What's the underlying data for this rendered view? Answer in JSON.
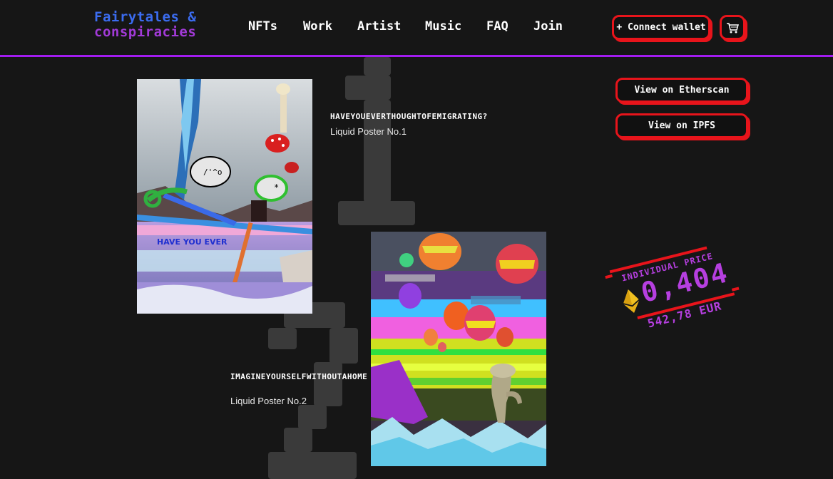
{
  "header": {
    "logo_line1": "Fairytales &",
    "logo_line2": "conspiracies",
    "nav": [
      "NFTs",
      "Work",
      "Artist",
      "Music",
      "FAQ",
      "Join"
    ],
    "connect_label": "+ Connect wallet",
    "cart_icon": "cart-icon"
  },
  "actions": {
    "etherscan_label": "View on Etherscan",
    "ipfs_label": "View on IPFS"
  },
  "posters": [
    {
      "number": "1",
      "title": "HAVEYOUEVERTHOUGHTOFEMIGRATING?",
      "subtitle": "Liquid Poster No.1",
      "image_text": "HAVE YOU EVER",
      "bubble_text": "/'^o"
    },
    {
      "number": "2",
      "title": "IMAGINEYOURSELFWITHOUTAHOME",
      "subtitle": "Liquid Poster No.2"
    }
  ],
  "price": {
    "label": "INDIVIDUAL PRICE",
    "eth_value": "0,404",
    "eur_value": "542,78 EUR",
    "currency_icon": "ethereum-icon"
  },
  "colors": {
    "background": "#161616",
    "accent_red": "#e8141b",
    "accent_purple": "#a21cf0",
    "logo_blue": "#3b6cf0"
  }
}
